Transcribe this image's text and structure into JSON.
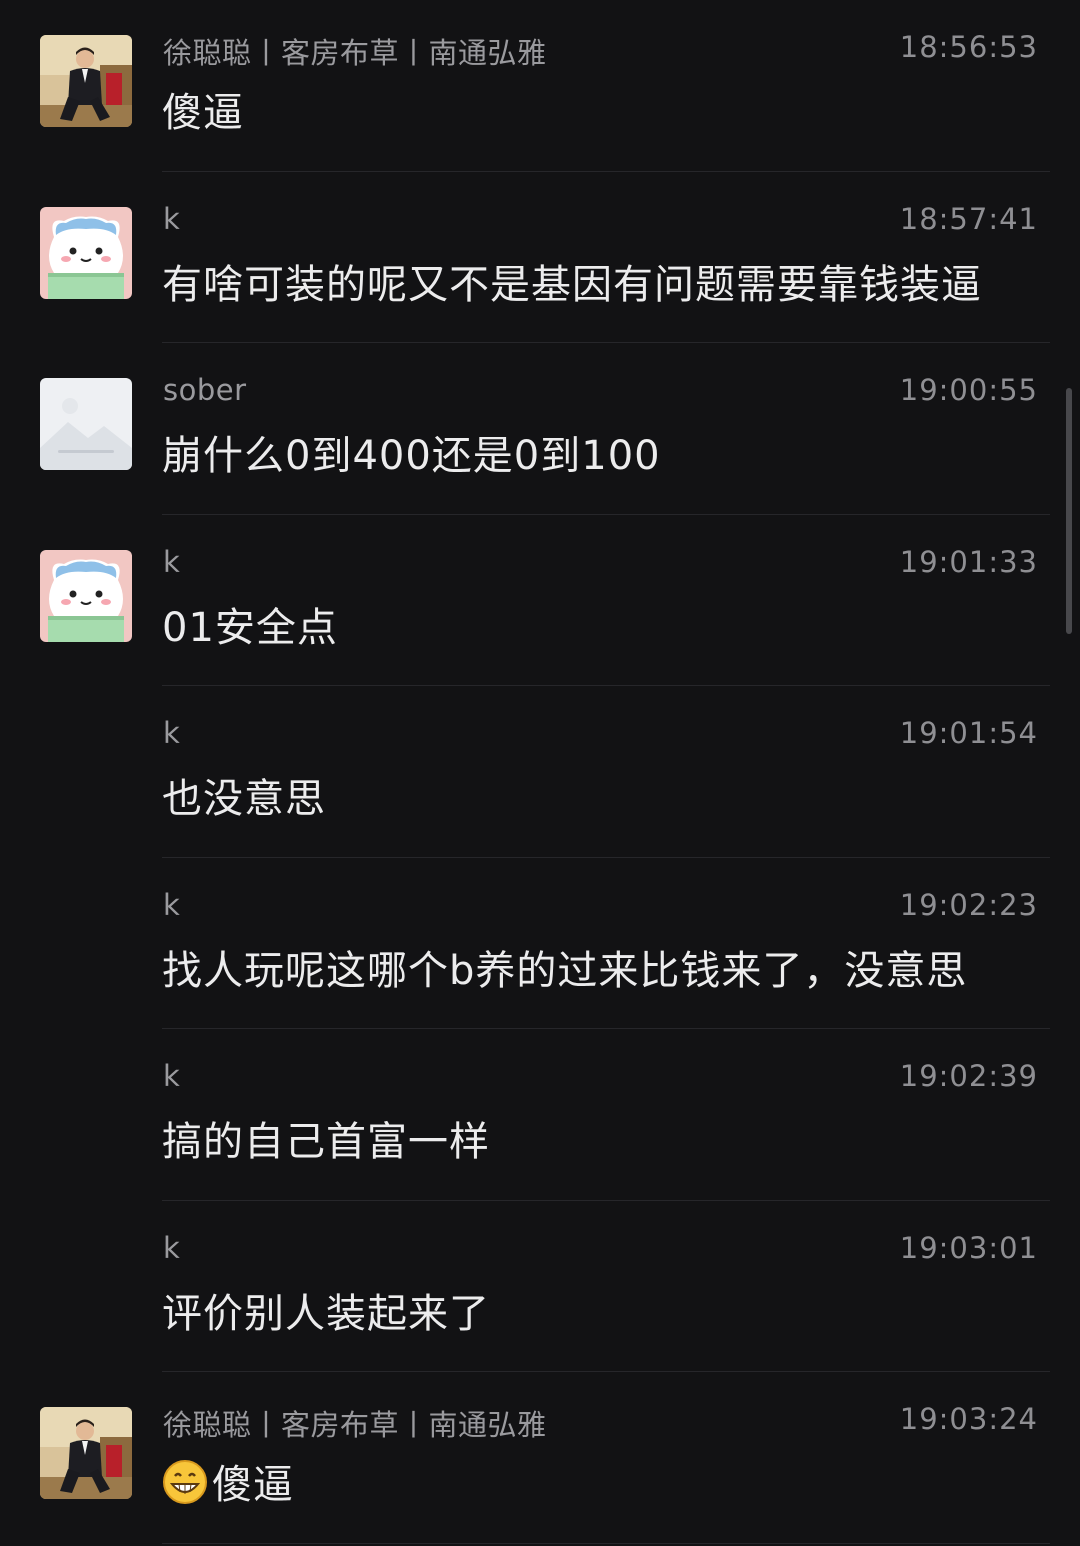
{
  "colors": {
    "background": "#121214",
    "sender_text": "#9a9a9e",
    "time_text": "#8f8f93",
    "message_text": "#ececed",
    "divider": "#26262a"
  },
  "messages": [
    {
      "sender": "徐聪聪丨客房布草丨南通弘雅",
      "time": "18:56:53",
      "text": "傻逼",
      "avatar": "man-in-suit-avatar"
    },
    {
      "sender": "k",
      "time": "18:57:41",
      "text": "有啥可装的呢又不是基因有问题需要靠钱装逼",
      "avatar": "cartoon-cat-avatar"
    },
    {
      "sender": "sober",
      "time": "19:00:55",
      "text": "崩什么0到400还是0到100",
      "avatar": "faded-image-avatar"
    },
    {
      "sender": "k",
      "time": "19:01:33",
      "text": "01安全点",
      "avatar": "cartoon-cat-avatar"
    },
    {
      "sender": "k",
      "time": "19:01:54",
      "text": "也没意思",
      "avatar": ""
    },
    {
      "sender": "k",
      "time": "19:02:23",
      "text": "找人玩呢这哪个b养的过来比钱来了，没意思",
      "avatar": ""
    },
    {
      "sender": "k",
      "time": "19:02:39",
      "text": "搞的自己首富一样",
      "avatar": ""
    },
    {
      "sender": "k",
      "time": "19:03:01",
      "text": "评价别人装起来了",
      "avatar": ""
    },
    {
      "sender": "徐聪聪丨客房布草丨南通弘雅",
      "time": "19:03:24",
      "text": "傻逼",
      "avatar": "man-in-suit-avatar",
      "leading_icon": "grinning-emoji-icon"
    }
  ]
}
